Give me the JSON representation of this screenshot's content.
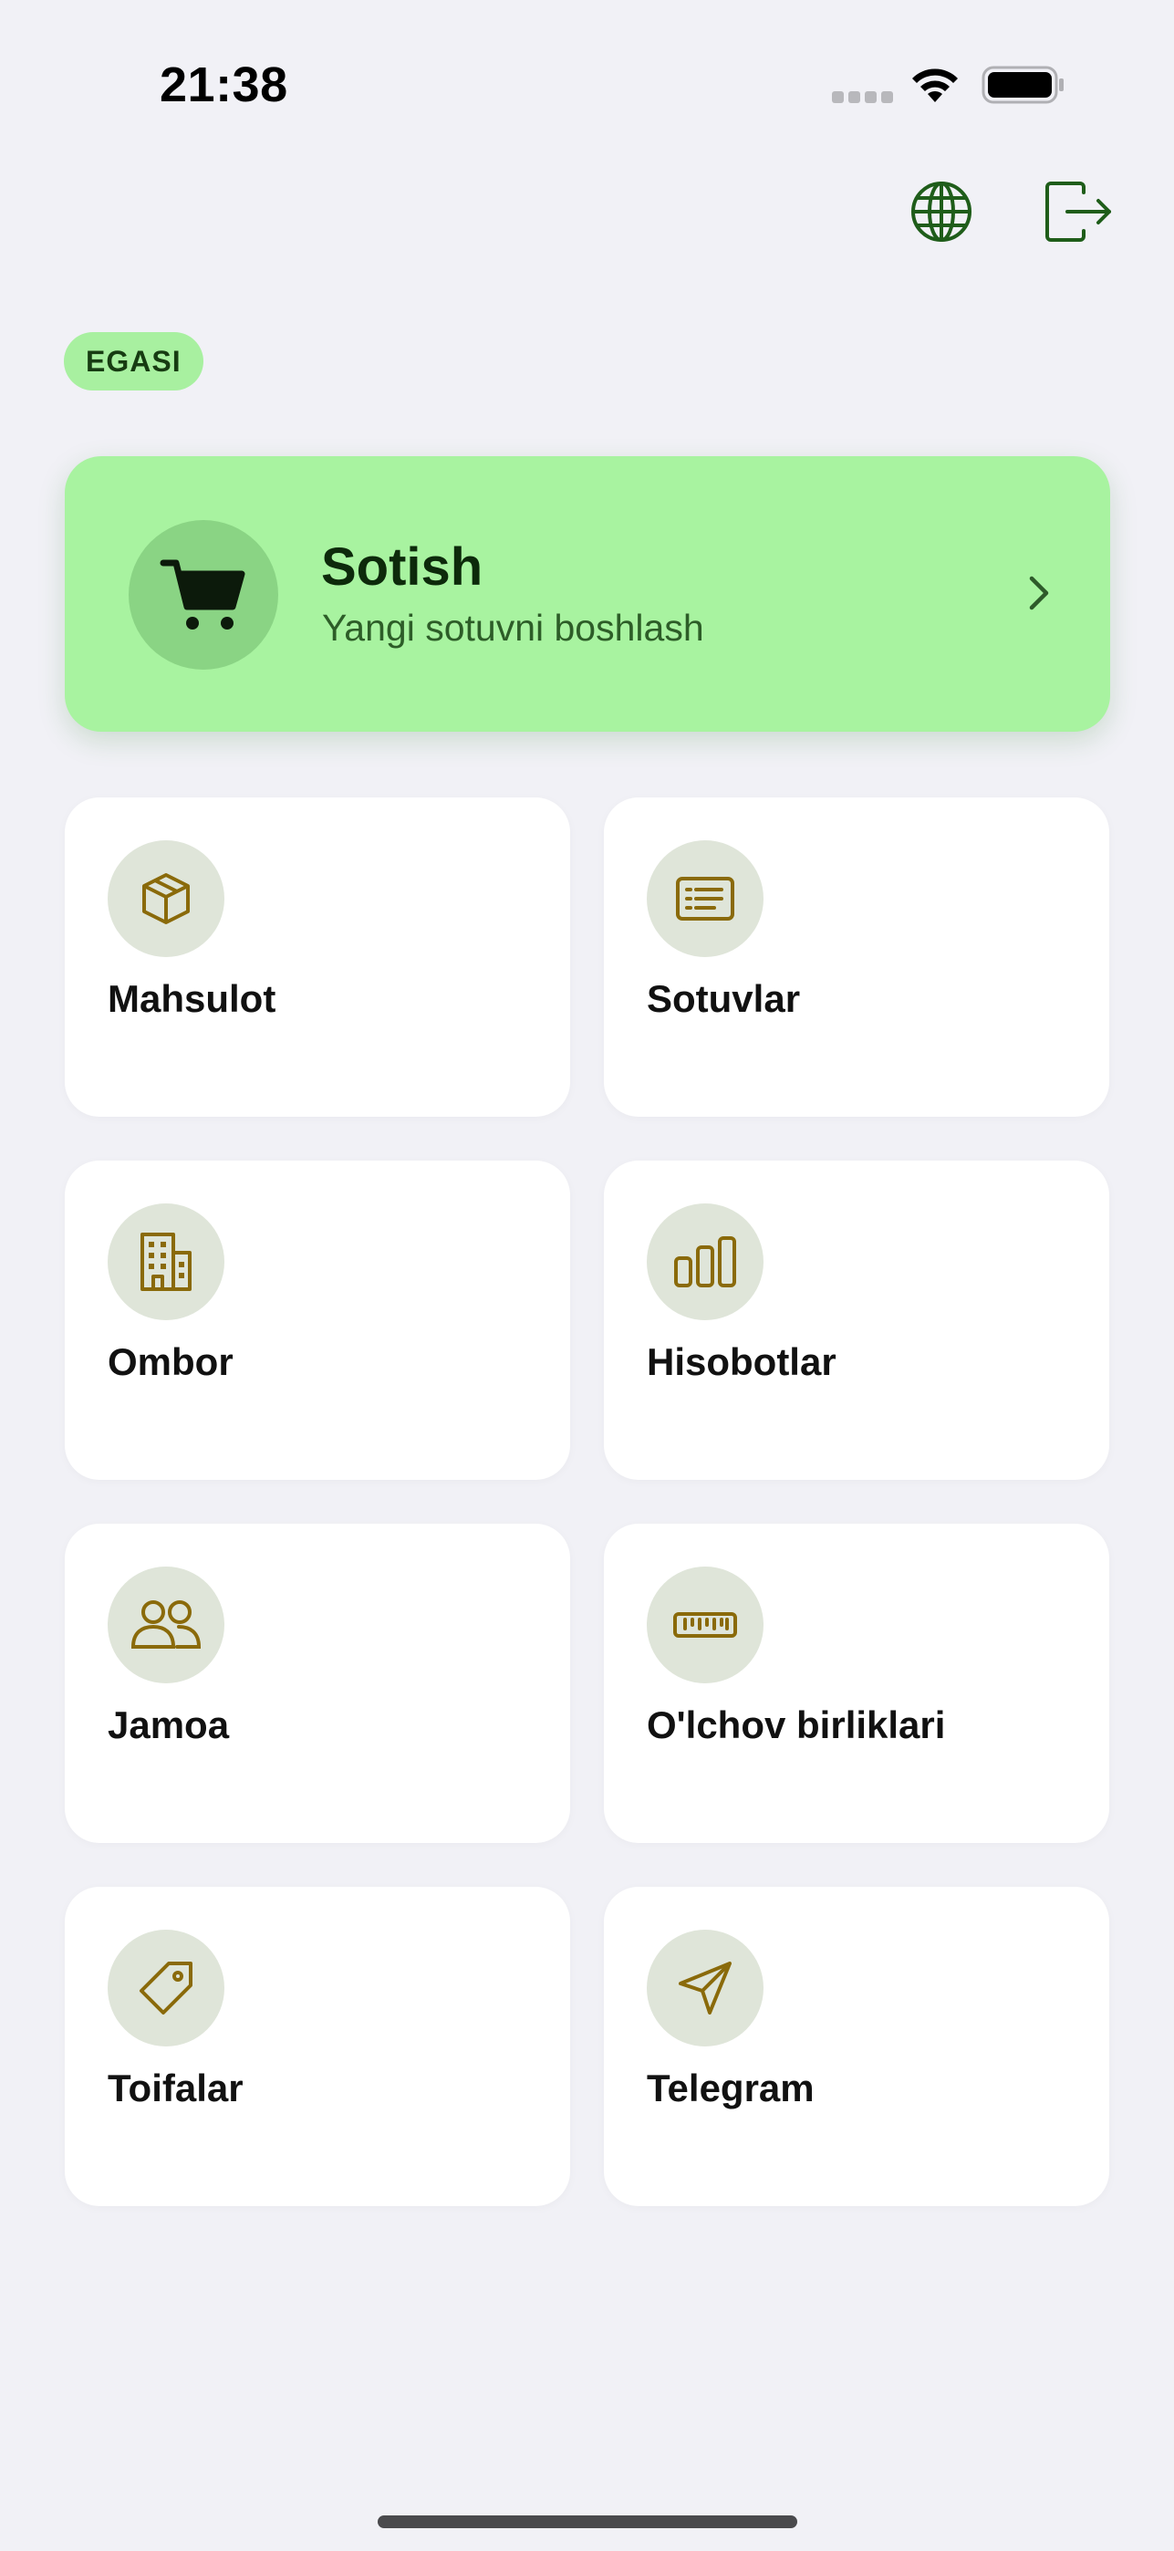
{
  "status_bar": {
    "time": "21:38"
  },
  "header": {
    "icons": {
      "language": "globe-icon",
      "logout": "logout-icon"
    }
  },
  "role_badge": "EGASI",
  "hero": {
    "title": "Sotish",
    "subtitle": "Yangi sotuvni boshlash",
    "icon": "cart-icon",
    "color": "#a8f3a0"
  },
  "tiles": [
    {
      "label": "Mahsulot",
      "icon": "box-icon"
    },
    {
      "label": "Sotuvlar",
      "icon": "receipt-icon"
    },
    {
      "label": "Ombor",
      "icon": "building-icon"
    },
    {
      "label": "Hisobotlar",
      "icon": "bar-chart-icon"
    },
    {
      "label": "Jamoa",
      "icon": "users-icon"
    },
    {
      "label": "O'lchov birliklari",
      "icon": "ruler-icon"
    },
    {
      "label": "Toifalar",
      "icon": "tag-icon"
    },
    {
      "label": "Telegram",
      "icon": "send-icon"
    }
  ],
  "colors": {
    "background": "#f1f1f6",
    "accent_green": "#a8f3a0",
    "icon_dark_green": "#1f5d1a",
    "icon_gold": "#8a6a0a",
    "tile_icon_bg": "#dfe5d9"
  }
}
